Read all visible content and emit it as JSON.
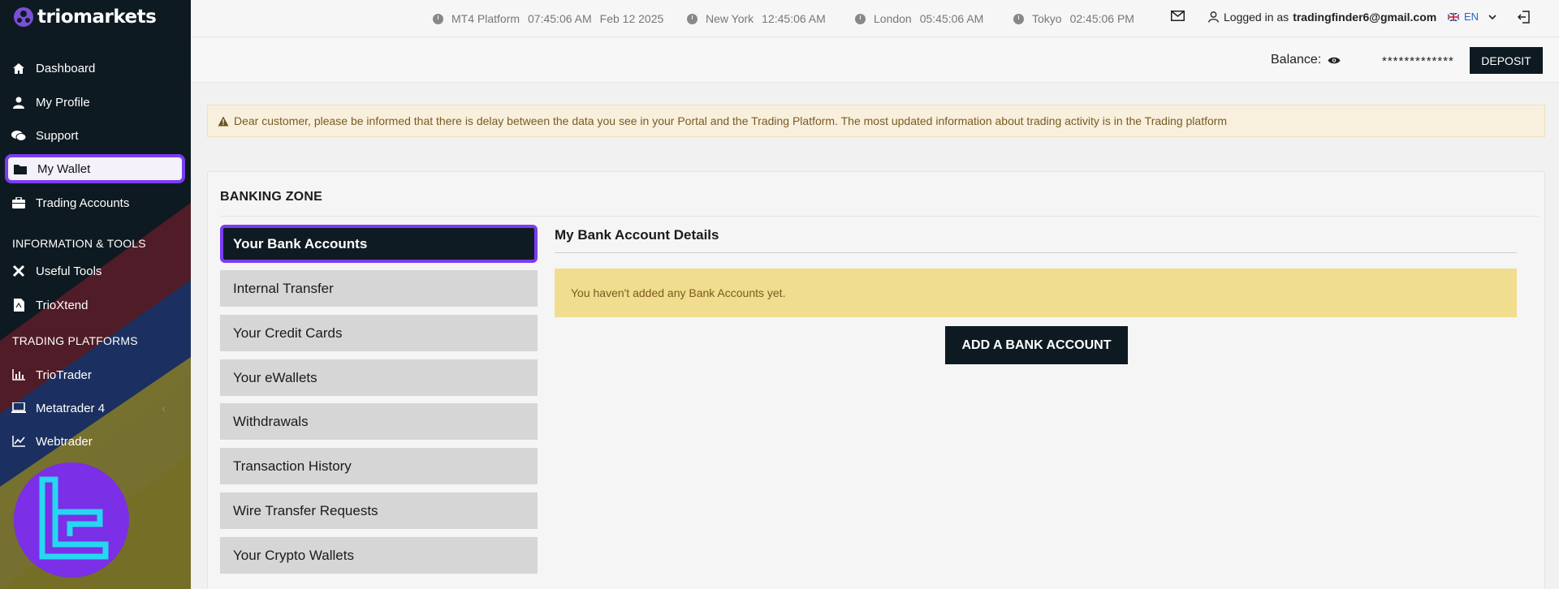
{
  "brand": {
    "name": "triomarkets"
  },
  "sidebar": {
    "items": [
      {
        "label": "Dashboard",
        "icon": "home-icon"
      },
      {
        "label": "My Profile",
        "icon": "user-icon"
      },
      {
        "label": "Support",
        "icon": "chat-icon"
      },
      {
        "label": "My Wallet",
        "icon": "folder-icon"
      },
      {
        "label": "Trading Accounts",
        "icon": "briefcase-icon"
      }
    ],
    "section_info": "INFORMATION & TOOLS",
    "tools": [
      {
        "label": "Useful Tools",
        "icon": "tools-icon"
      },
      {
        "label": "TrioXtend",
        "icon": "file-pdf-icon"
      }
    ],
    "section_platforms": "TRADING PLATFORMS",
    "platforms": [
      {
        "label": "TrioTrader",
        "icon": "bar-chart-icon"
      },
      {
        "label": "Metatrader 4",
        "icon": "laptop-icon"
      },
      {
        "label": "Webtrader",
        "icon": "line-chart-icon"
      }
    ]
  },
  "topbar": {
    "clocks": [
      {
        "label": "MT4 Platform",
        "time": "07:45:06 AM",
        "date": "Feb 12 2025"
      },
      {
        "label": "New York",
        "time": "12:45:06 AM"
      },
      {
        "label": "London",
        "time": "05:45:06 AM"
      },
      {
        "label": "Tokyo",
        "time": "02:45:06 PM"
      }
    ],
    "logged_in_prefix": "Logged in as",
    "user_email": "tradingfinder6@gmail.com",
    "language": "EN"
  },
  "balance": {
    "label": "Balance:",
    "masked_value": "*************",
    "deposit_label": "DEPOSIT"
  },
  "notice": {
    "text": "Dear customer, please be informed that there is delay between the data you see in your Portal and the Trading Platform. The most updated information about trading activity is in the Trading platform"
  },
  "banking": {
    "title": "BANKING ZONE",
    "tabs": [
      "Your Bank Accounts",
      "Internal Transfer",
      "Your Credit Cards",
      "Your eWallets",
      "Withdrawals",
      "Transaction History",
      "Wire Transfer Requests",
      "Your Crypto Wallets"
    ],
    "active_tab": "Your Bank Accounts",
    "details_title": "My Bank Account Details",
    "empty_message": "You haven't added any Bank Accounts yet.",
    "add_button": "ADD A BANK ACCOUNT"
  },
  "colors": {
    "sidebar_bg": "#0f1b22",
    "highlight": "#7a3cf2",
    "empty_banner": "#f0dd8e",
    "notice_bg": "#f8f0dd"
  }
}
